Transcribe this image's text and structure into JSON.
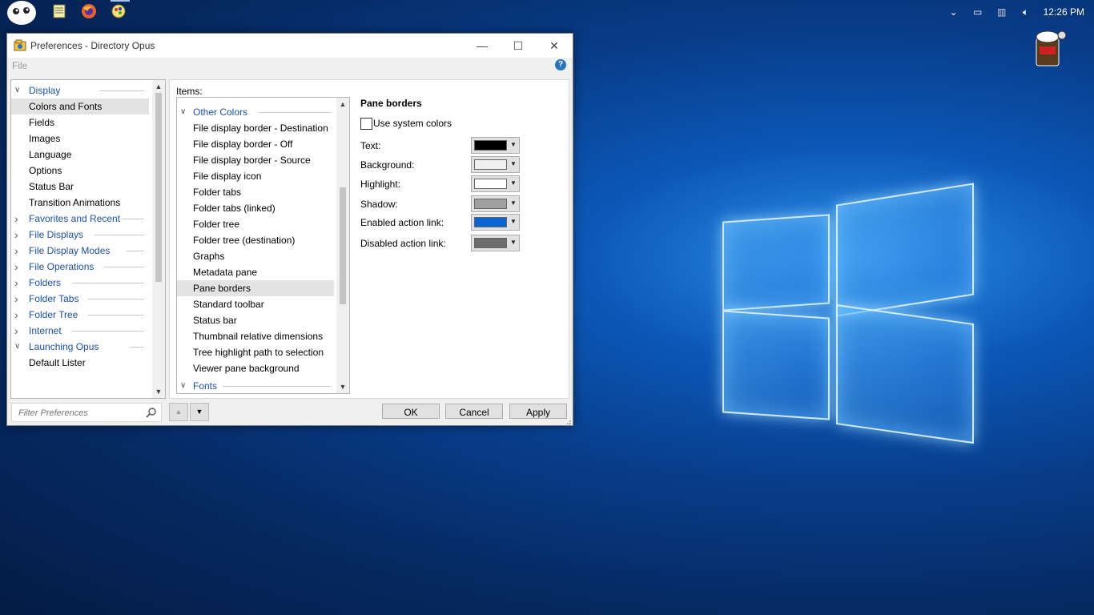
{
  "window": {
    "title": "Preferences - Directory Opus",
    "minimize": "—",
    "maximize": "☐",
    "close": "✕"
  },
  "menu": {
    "file": "File",
    "help": "?"
  },
  "tree": {
    "items": [
      {
        "label": "Display",
        "type": "category",
        "expanded": true
      },
      {
        "label": "Colors and Fonts",
        "type": "child",
        "selected": true
      },
      {
        "label": "Fields",
        "type": "child"
      },
      {
        "label": "Images",
        "type": "child"
      },
      {
        "label": "Language",
        "type": "child"
      },
      {
        "label": "Options",
        "type": "child"
      },
      {
        "label": "Status Bar",
        "type": "child"
      },
      {
        "label": "Transition Animations",
        "type": "child"
      },
      {
        "label": "Favorites and Recent",
        "type": "category",
        "expanded": false
      },
      {
        "label": "File Displays",
        "type": "category",
        "expanded": false
      },
      {
        "label": "File Display Modes",
        "type": "category",
        "expanded": false
      },
      {
        "label": "File Operations",
        "type": "category",
        "expanded": false
      },
      {
        "label": "Folders",
        "type": "category",
        "expanded": false
      },
      {
        "label": "Folder Tabs",
        "type": "category",
        "expanded": false
      },
      {
        "label": "Folder Tree",
        "type": "category",
        "expanded": false
      },
      {
        "label": "Internet",
        "type": "category",
        "expanded": false
      },
      {
        "label": "Launching Opus",
        "type": "category",
        "expanded": true
      },
      {
        "label": "Default Lister",
        "type": "child"
      }
    ]
  },
  "filter": {
    "placeholder": "Filter Preferences"
  },
  "items_panel": {
    "label": "Items:",
    "items": [
      {
        "label": "Other Colors",
        "type": "category"
      },
      {
        "label": "File display border - Destination",
        "type": "child"
      },
      {
        "label": "File display border - Off",
        "type": "child"
      },
      {
        "label": "File display border - Source",
        "type": "child"
      },
      {
        "label": "File display icon",
        "type": "child"
      },
      {
        "label": "Folder tabs",
        "type": "child"
      },
      {
        "label": "Folder tabs (linked)",
        "type": "child"
      },
      {
        "label": "Folder tree",
        "type": "child"
      },
      {
        "label": "Folder tree (destination)",
        "type": "child"
      },
      {
        "label": "Graphs",
        "type": "child"
      },
      {
        "label": "Metadata pane",
        "type": "child"
      },
      {
        "label": "Pane borders",
        "type": "child",
        "selected": true
      },
      {
        "label": "Standard toolbar",
        "type": "child"
      },
      {
        "label": "Status bar",
        "type": "child"
      },
      {
        "label": "Thumbnail relative dimensions",
        "type": "child"
      },
      {
        "label": "Tree highlight path to selection",
        "type": "child"
      },
      {
        "label": "Viewer pane background",
        "type": "child"
      },
      {
        "label": "Fonts",
        "type": "category"
      }
    ]
  },
  "props": {
    "heading": "Pane borders",
    "use_system_colors": {
      "label": "Use system colors",
      "checked": false
    },
    "rows": [
      {
        "label": "Text:",
        "color": "#000000"
      },
      {
        "label": "Background:",
        "color": "#f0f0f0"
      },
      {
        "label": "Highlight:",
        "color": "#ffffff"
      },
      {
        "label": "Shadow:",
        "color": "#a0a0a0"
      },
      {
        "label": "Enabled action link:",
        "color": "#0a64d2"
      },
      {
        "label": "Disabled action link:",
        "color": "#6d6d6d"
      }
    ]
  },
  "buttons": {
    "ok": "OK",
    "cancel": "Cancel",
    "apply": "Apply"
  },
  "tray": {
    "clock": "12:26 PM"
  }
}
